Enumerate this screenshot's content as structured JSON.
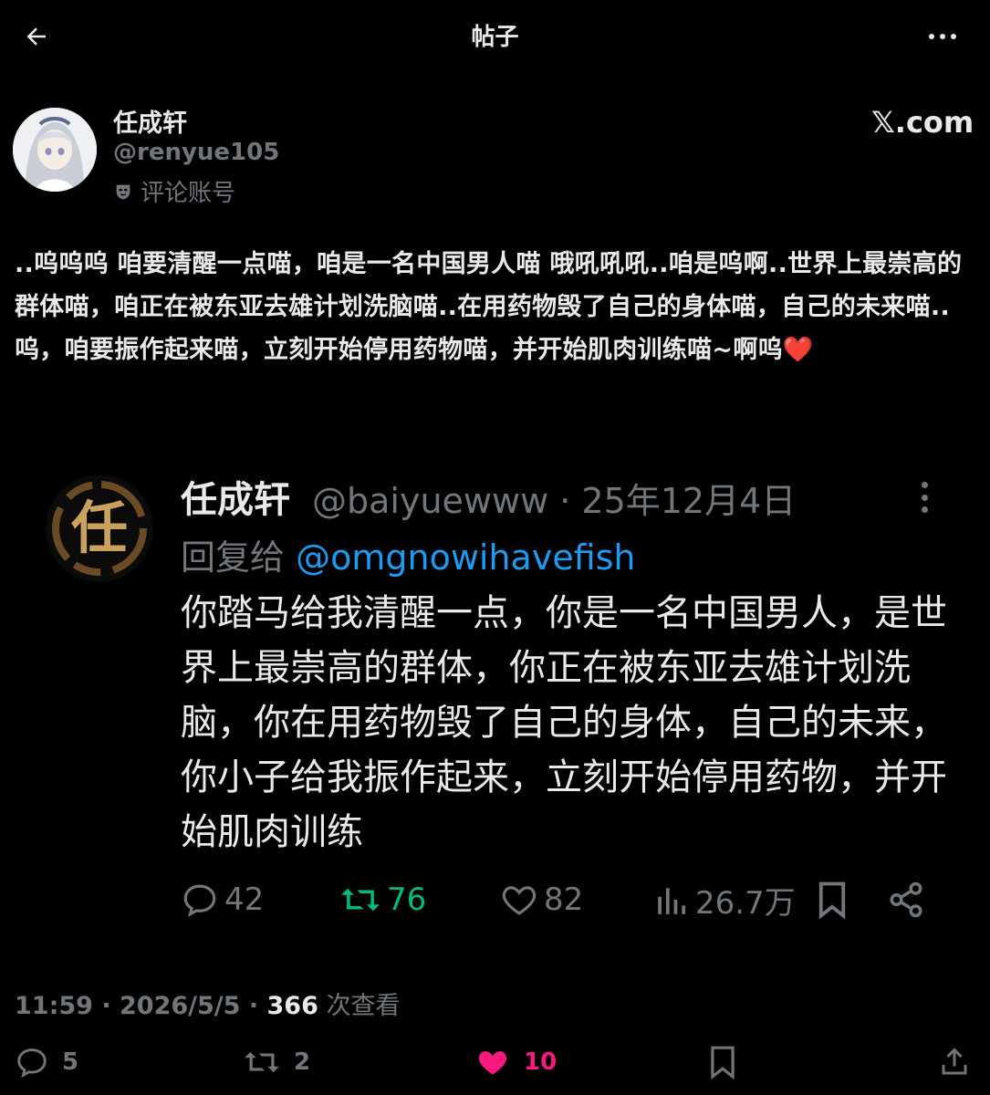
{
  "header": {
    "title": "帖子",
    "back_icon": "back-arrow-icon",
    "more_icon": "more-horizontal-icon"
  },
  "author": {
    "name": "任成轩",
    "handle": "@renyue105",
    "label": "评论账号",
    "label_icon": "mask-icon",
    "site": "𝕏.com"
  },
  "post": {
    "text": "..呜呜呜 咱要清醒一点喵，咱是一名中国男人喵 哦吼吼吼..咱是呜啊..世界上最崇高的群体喵，咱正在被东亚去雄计划洗脑喵..在用药物毁了自己的身体喵，自己的未来喵..呜，咱要振作起来喵，立刻开始停用药物喵，并开始肌肉训练喵~啊呜❤️"
  },
  "quoted": {
    "avatar_char": "任",
    "name": "任成轩",
    "meta": "@baiyuewww · 25年12月4日",
    "reply_prefix": "回复给",
    "reply_to": "@omgnowihavefish",
    "text": "你踏马给我清醒一点，你是一名中国男人，是世界上最崇高的群体，你正在被东亚去雄计划洗脑，你在用药物毁了自己的身体，自己的未来，你小子给我振作起来，立刻开始停用药物，并开始肌肉训练",
    "actions": {
      "replies": "42",
      "retweets": "76",
      "likes": "82",
      "views": "26.7万"
    },
    "colors": {
      "retweet": "#00ba7c",
      "mention": "#1d9bf0"
    }
  },
  "timestamp": {
    "time": "11:59 · 2026/5/5 · ",
    "views": "366",
    "views_label": " 次查看"
  },
  "bottom_actions": {
    "replies": "5",
    "retweets": "2",
    "likes": "10",
    "like_color": "#f91880"
  }
}
